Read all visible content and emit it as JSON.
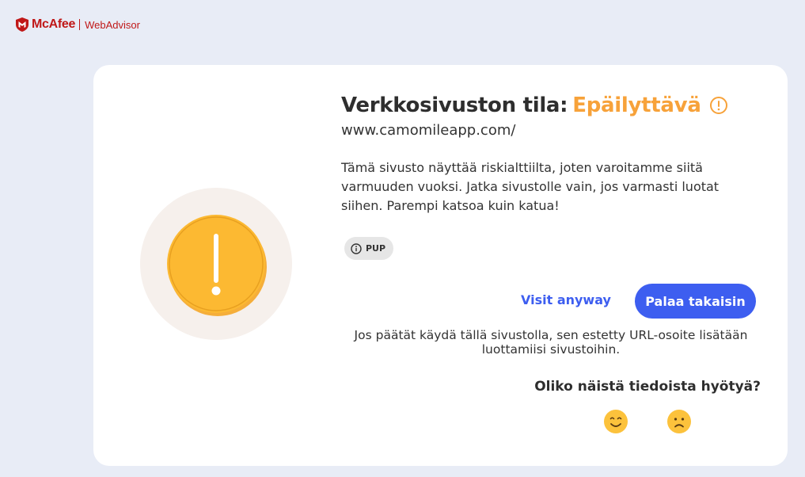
{
  "brand": {
    "name": "McAfee",
    "product": "WebAdvisor",
    "icon": "mcafee-shield-icon",
    "color": "#c01818"
  },
  "page": {
    "title_prefix": "Verkkosivuston tila:",
    "status": "Epäilyttävä",
    "status_color": "#f7a23a",
    "url": "www.camomileapp.com/",
    "description": "Tämä sivusto näyttää riskialttiilta, joten varoitamme siitä varmuuden vuoksi. Jatka sivustolle vain, jos varmasti luotat siihen. Parempi katsoa kuin katua!",
    "tag": "PUP",
    "visit_label": "Visit anyway",
    "back_label": "Palaa takaisin",
    "accent_color": "#3d5ef0",
    "note": "Jos päätät käydä tällä sivustolla, sen estetty URL-osoite lisätään luottamiisi sivustoihin.",
    "feedback_question": "Oliko näistä tiedoista hyötyä?",
    "feedback_icons": [
      "smiling-face-icon",
      "sad-face-icon"
    ]
  }
}
